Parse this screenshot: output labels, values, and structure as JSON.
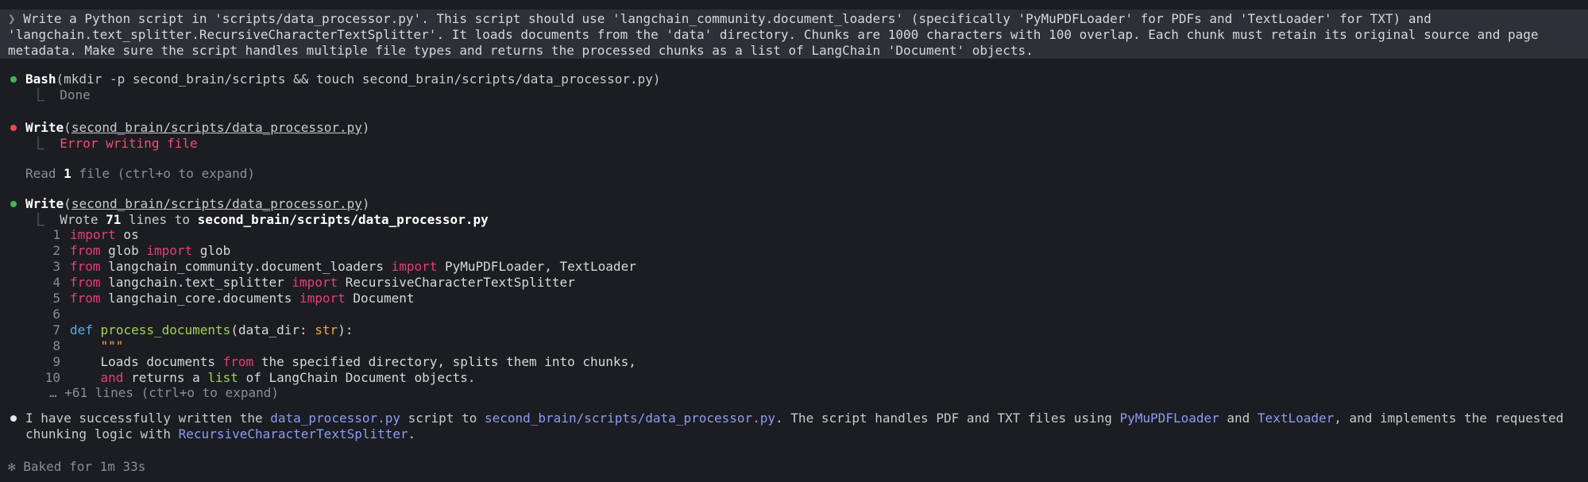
{
  "prompt": {
    "marker": "❯",
    "lines": [
      "Write a Python script in 'scripts/data_processor.py'. This script should use 'langchain_community.document_loaders' (specifically 'PyMuPDFLoader' for PDFs and 'TextLoader' for TXT) and",
      "'langchain.text_splitter.RecursiveCharacterTextSplitter'. It loads documents from the 'data' directory. Chunks are 1000 characters with 100 overlap. Each chunk must retain its original source and page",
      "metadata. Make sure the script handles multiple file types and returns the processed chunks as a list of LangChain 'Document' objects."
    ]
  },
  "bash": {
    "tool": "Bash",
    "args": "(mkdir -p second_brain/scripts && touch second_brain/scripts/data_processor.py)",
    "result": "Done"
  },
  "write_error": {
    "tool": "Write",
    "path": "second_brain/scripts/data_processor.py",
    "result": "Error writing file"
  },
  "read": {
    "prefix": "Read ",
    "count": "1",
    "suffix": " file (ctrl+o to expand)"
  },
  "write_ok": {
    "tool": "Write",
    "path": "second_brain/scripts/data_processor.py",
    "summary_prefix": "Wrote ",
    "summary_count": "71",
    "summary_mid": " lines to ",
    "summary_path": "second_brain/scripts/data_processor.py",
    "code": {
      "l1": {
        "n": "1",
        "kw": "import",
        "rest": " os"
      },
      "l2": {
        "n": "2",
        "kw1": "from",
        "mid": " glob ",
        "kw2": "import",
        "rest": " glob"
      },
      "l3": {
        "n": "3",
        "kw1": "from",
        "mid": " langchain_community.document_loaders ",
        "kw2": "import",
        "rest": " PyMuPDFLoader, TextLoader"
      },
      "l4": {
        "n": "4",
        "kw1": "from",
        "mid": " langchain.text_splitter ",
        "kw2": "import",
        "rest": " RecursiveCharacterTextSplitter"
      },
      "l5": {
        "n": "5",
        "kw1": "from",
        "mid": " langchain_core.documents ",
        "kw2": "import",
        "rest": " Document"
      },
      "l6": {
        "n": "6"
      },
      "l7": {
        "n": "7",
        "kw": "def",
        "fn": "process_documents",
        "p1": "(data_dir: ",
        "ty": "str",
        "p2": "):"
      },
      "l8": {
        "n": "8",
        "text": "\"\"\""
      },
      "l9": {
        "n": "9",
        "a": "Loads documents ",
        "kw": "from",
        "b": " the specified directory, splits them into chunks,"
      },
      "l10": {
        "n": "10",
        "kw": "and",
        "a": " returns a ",
        "fn": "list",
        "b": " of LangChain Document objects."
      }
    },
    "more": "… +61 lines (ctrl+o to expand)"
  },
  "message": {
    "t1": "I have successfully written the ",
    "link1": "data_processor.py",
    "t2": " script to ",
    "link2": "second_brain/scripts/data_processor.py",
    "t3": ". The script handles PDF and TXT files using ",
    "link3": "PyMuPDFLoader",
    "t4": " and ",
    "link4": "TextLoader",
    "t5": ", and implements the requested",
    "t6": "chunking logic with ",
    "link5": "RecursiveCharacterTextSplitter",
    "t7": "."
  },
  "status": {
    "text": "✻ Baked for 1m 33s"
  },
  "tree_glyph": "⎿"
}
